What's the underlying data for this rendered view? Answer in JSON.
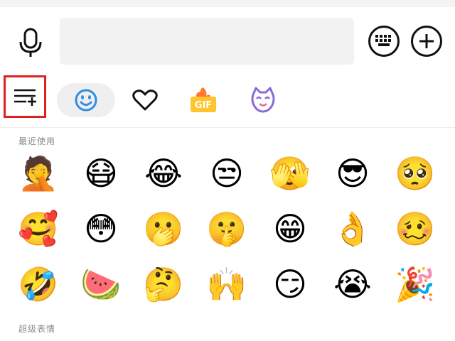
{
  "input": {
    "value": "",
    "placeholder": ""
  },
  "icons": {
    "voice": "microphone-icon",
    "keyboard": "keyboard-icon",
    "plus": "plus-icon",
    "manage": "sticker-manage-icon",
    "emoji_tab": "smiley-icon",
    "favorites_tab": "heart-icon",
    "gif_tab": "gif-icon",
    "cute_tab": "cat-face-icon"
  },
  "tabs": {
    "gif_label": "GIF"
  },
  "sections": {
    "recent": "最近使用",
    "super": "超级表情"
  },
  "emojis": [
    {
      "name": "facepalm-laugh"
    },
    {
      "name": "angry-mask"
    },
    {
      "name": "tears-of-joy"
    },
    {
      "name": "side-eye"
    },
    {
      "name": "peek"
    },
    {
      "name": "cool-sunglasses"
    },
    {
      "name": "shy"
    },
    {
      "name": "hold-flower"
    },
    {
      "name": "question"
    },
    {
      "name": "cover-face"
    },
    {
      "name": "shush"
    },
    {
      "name": "grin-teeth"
    },
    {
      "name": "ok-hand"
    },
    {
      "name": "pout"
    },
    {
      "name": "crying-laugh"
    },
    {
      "name": "watermelon"
    },
    {
      "name": "thinking"
    },
    {
      "name": "hands-up-laugh"
    },
    {
      "name": "smirk"
    },
    {
      "name": "crying"
    },
    {
      "name": "party-popper"
    }
  ],
  "colors": {
    "accent_blue": "#2f8de4",
    "highlight_red": "#e02020",
    "emoji_yellow": "#ffc936",
    "heart_outline": "#111111"
  }
}
